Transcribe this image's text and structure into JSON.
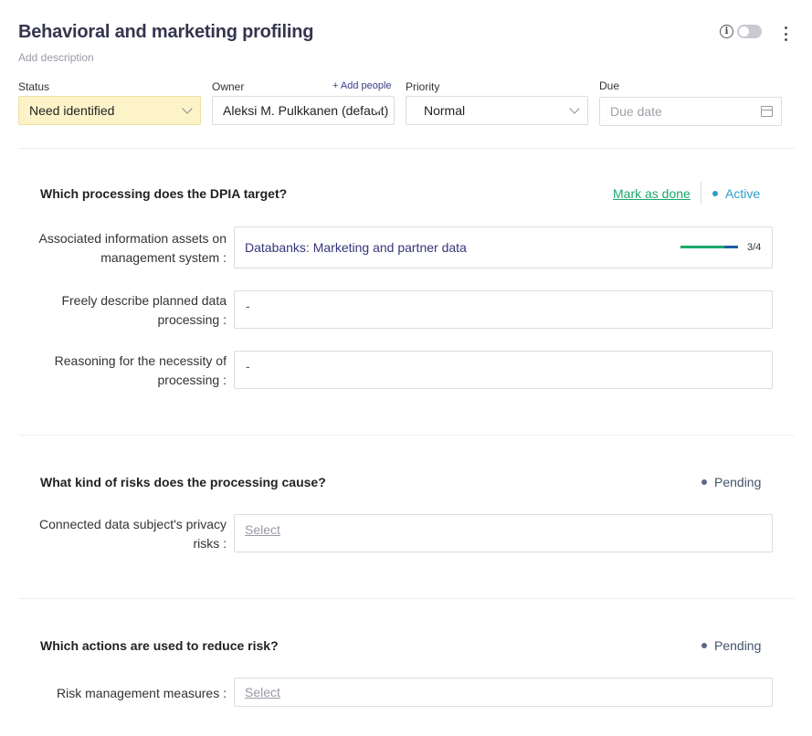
{
  "header": {
    "title": "Behavioral and marketing profiling",
    "add_description": "Add description",
    "info_icon_glyph": "i"
  },
  "fields": {
    "status": {
      "label": "Status",
      "value": "Need identified",
      "color": "#fcf3c8"
    },
    "owner": {
      "label": "Owner",
      "value": "Aleksi M. Pulkkanen (default)",
      "add_people": "+ Add people"
    },
    "priority": {
      "label": "Priority",
      "value": "Normal"
    },
    "due": {
      "label": "Due",
      "placeholder": "Due date"
    }
  },
  "sections": [
    {
      "title": "Which processing does the DPIA target?",
      "mark_as_done": "Mark as done",
      "status": "Active",
      "status_color": "#2d9fc9",
      "rows": [
        {
          "label_line1": "Associated information assets on",
          "label_line2": "management system :",
          "value": "Databanks: Marketing and partner data",
          "progress": 0.75,
          "progress_text": "3/4"
        },
        {
          "label_line1": "Freely describe planned data",
          "label_line2": "processing :",
          "value": "-"
        },
        {
          "label_line1": "Reasoning for the necessity of",
          "label_line2": "processing :",
          "value": "-"
        }
      ]
    },
    {
      "title": "What kind of risks does the processing cause?",
      "status": "Pending",
      "rows": [
        {
          "label_line1": "Connected data subject's privacy",
          "label_line2": "risks :",
          "value": "Select"
        }
      ]
    },
    {
      "title": "Which actions are used to reduce risk?",
      "status": "Pending",
      "rows": [
        {
          "label_line1": "Risk management measures :",
          "value": "Select"
        }
      ]
    }
  ],
  "icons": {
    "info": "info-icon",
    "toggle": "toggle-switch",
    "more": "kebab-menu-icon",
    "chevron": "chevron-down-icon",
    "calendar": "calendar-icon"
  }
}
